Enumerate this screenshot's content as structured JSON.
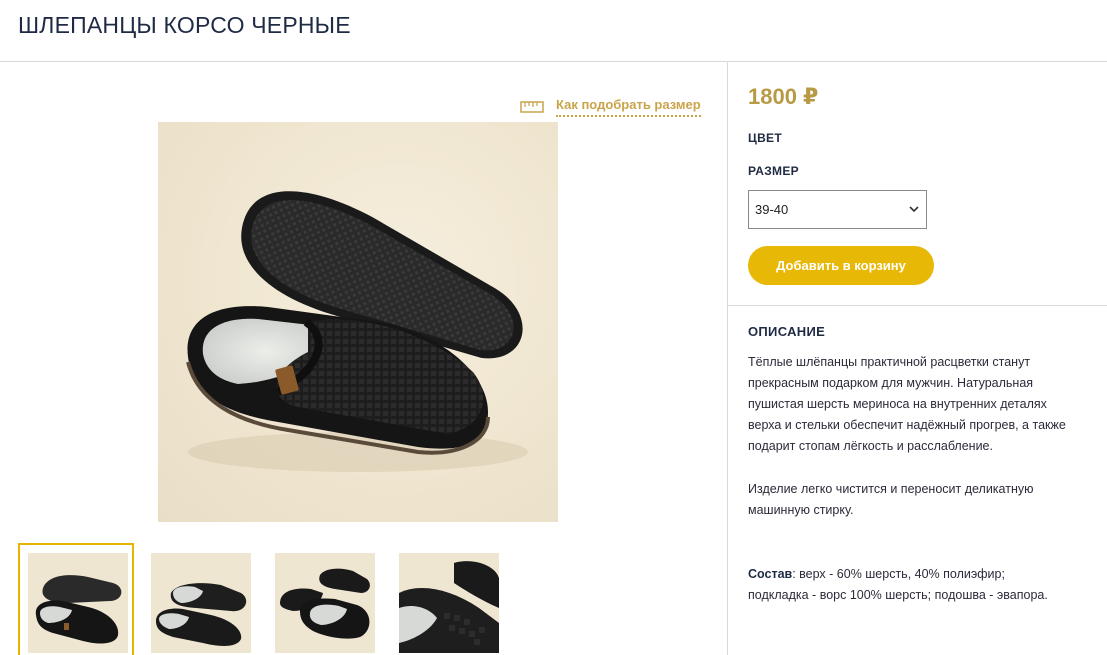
{
  "product": {
    "title": "ШЛЕПАНЦЫ КОРСО ЧЕРНЫЕ",
    "price": "1800 ₽",
    "color_label": "ЦВЕТ",
    "size_label": "РАЗМЕР",
    "size_selected": "39-40",
    "add_to_cart": "Добавить в корзину",
    "size_guide": "Как подобрать размер"
  },
  "description": {
    "heading": "ОПИСАНИЕ",
    "paragraph1": "Тёплые шлёпанцы практичной расцветки станут прекрасным подарком для мужчин. Натуральная пушистая шерсть мериноса на внутренних деталях верха и стельки обеспечит надёжный прогрев, а также подарит стопам лёгкость и расслабление.",
    "paragraph2": "Изделие легко чистится и переносит деликатную машинную стирку.",
    "composition_label": "Состав",
    "composition_text": ": верх - 60% шерсть, 40% полиэфир; подкладка - ворс 100% шерсть; подошва - эвапора."
  },
  "gallery": {
    "thumbnails": [
      "thumb-1",
      "thumb-2",
      "thumb-3",
      "thumb-4"
    ],
    "active_index": 0
  },
  "colors": {
    "accent_gold": "#c9a44a",
    "button_yellow": "#e7b805",
    "text_dark": "#1f2a44",
    "product_black": "#1c1c1c",
    "wool": "#d9dcd8"
  },
  "icons": {
    "size_guide": "ruler-icon",
    "select": "chevron-down-icon"
  }
}
